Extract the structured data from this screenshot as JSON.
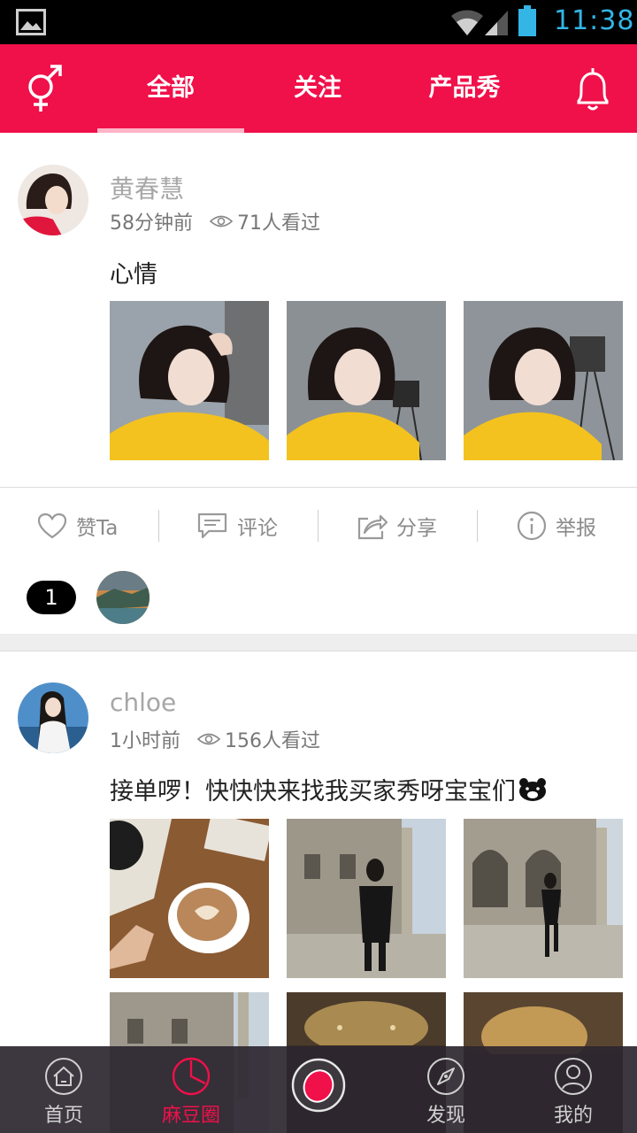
{
  "status_bar": {
    "time": "11:38"
  },
  "header": {
    "tabs": [
      {
        "label": "全部",
        "active": true
      },
      {
        "label": "关注",
        "active": false
      },
      {
        "label": "产品秀",
        "active": false
      }
    ],
    "left_icon": "gender-icon",
    "right_icon": "bell-icon"
  },
  "posts": [
    {
      "username": "黄春慧",
      "time_ago": "58分钟前",
      "views": "71人看过",
      "text": "心情",
      "image_count": 3,
      "actions": {
        "like": "赞Ta",
        "comment": "评论",
        "share": "分享",
        "report": "举报"
      },
      "like_count": "1"
    },
    {
      "username": "chloe",
      "time_ago": "1小时前",
      "views": "156人看过",
      "text": "接单啰！快快快来找我买家秀呀宝宝们",
      "image_count": 6
    }
  ],
  "bottom_nav": {
    "items": [
      {
        "label": "首页",
        "icon": "home-icon",
        "active": false
      },
      {
        "label": "麻豆圈",
        "icon": "pie-chart-icon",
        "active": true
      },
      {
        "label": "",
        "icon": "publish-icon",
        "active": false
      },
      {
        "label": "发现",
        "icon": "compass-icon",
        "active": false
      },
      {
        "label": "我的",
        "icon": "user-icon",
        "active": false
      }
    ]
  },
  "colors": {
    "brand": "#f0104a",
    "status_clock": "#33b5e5",
    "nav_bg": "#2d2630"
  }
}
